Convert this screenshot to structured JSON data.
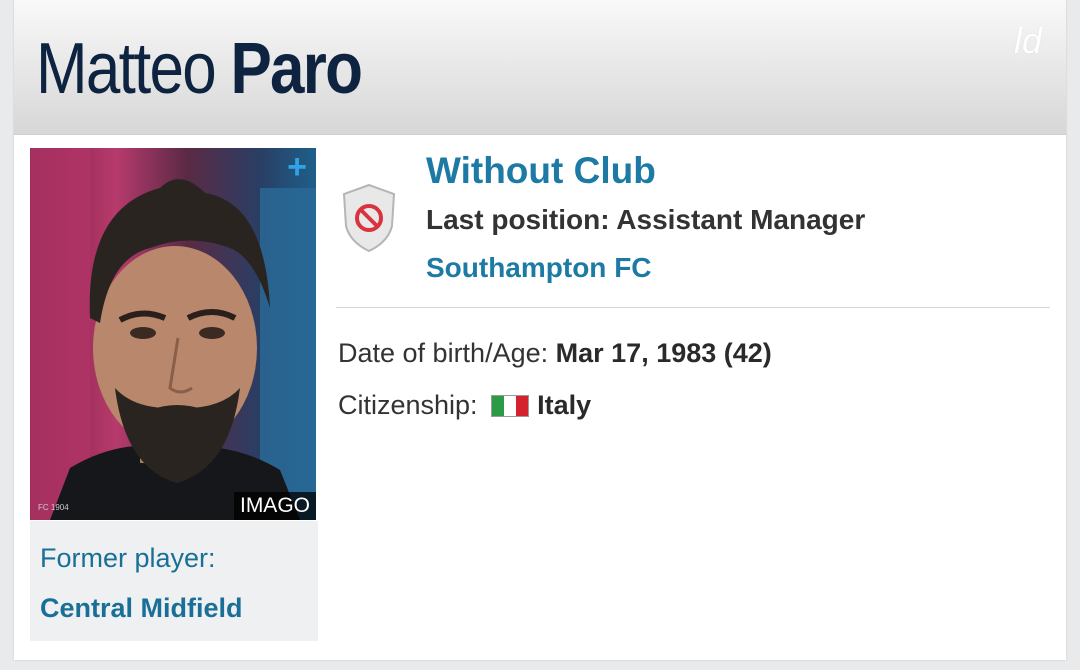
{
  "profile": {
    "first_name": "Matteo",
    "last_name": "Paro",
    "corner_logo": "ld",
    "photo_credit": "IMAGO",
    "former_label": "Former player:",
    "former_position": "Central Midfield",
    "club_status": "Without Club",
    "last_position": "Last position: Assistant Manager",
    "last_club": "Southampton FC",
    "dob_label": "Date of birth/Age:",
    "dob_value": "Mar 17, 1983 (42)",
    "citizenship_label": "Citizenship:",
    "citizenship_value": "Italy"
  },
  "icons": {
    "add_photo": "plus-icon",
    "club": "no-club-shield-icon",
    "flag": "italy-flag-icon"
  },
  "colors": {
    "name": "#0d2340",
    "link": "#1d7aa5",
    "accent_plus": "#2ea4e6"
  }
}
